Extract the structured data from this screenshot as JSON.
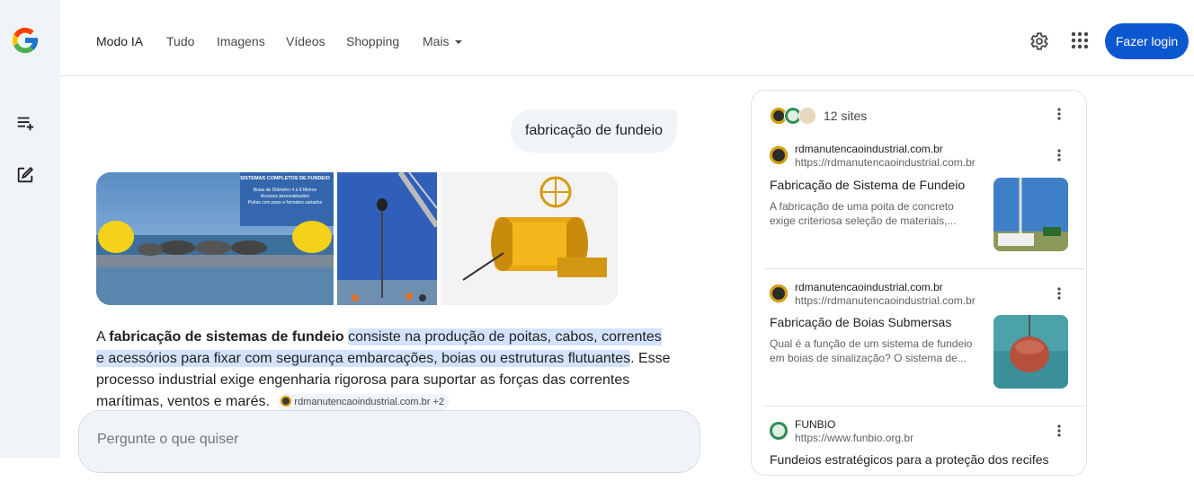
{
  "nav": {
    "tabs": [
      {
        "label": "Modo IA",
        "active": true
      },
      {
        "label": "Tudo"
      },
      {
        "label": "Imagens"
      },
      {
        "label": "Vídeos"
      },
      {
        "label": "Shopping"
      },
      {
        "label": "Mais"
      }
    ],
    "login_label": "Fazer login",
    "icons": [
      "settings-gear-icon",
      "apps-grid-icon"
    ]
  },
  "rail": {
    "icons": [
      "google-logo",
      "new-thread-icon",
      "edit-icon"
    ]
  },
  "colors": {
    "accent": "#0b57d0",
    "highlight": "#d3e3fd",
    "surface": "#f0f4f9"
  },
  "conversation": {
    "query": "fabricação de fundeio",
    "image_banner_text": {
      "title": "SISTEMAS COMPLETOS DE FUNDEIO",
      "lines": [
        "Boias de Diâmetro 4 à 8 Metros",
        "Acessos personalizados",
        "Poitas com peso e formatos variados"
      ]
    },
    "answer": {
      "part1": "A ",
      "bold": "fabricação de sistemas de fundeio",
      "part2": " ",
      "highlight": "consiste na produção de poitas, cabos, correntes e acessórios para fixar com segurança embarcações, boias ou estruturas flutuantes",
      "part3": ". Esse processo industrial exige engenharia rigorosa para suportar as forças das correntes marítimas, ventos e marés.",
      "chip_label": "rdmanutencaoindustrial.com.br",
      "chip_extra": "+2"
    }
  },
  "ask": {
    "placeholder": "Pergunte o que quiser"
  },
  "sources": {
    "count_label": "12 sites",
    "items": [
      {
        "domain": "rdmanutencaoindustrial.com.br",
        "url": "https://rdmanutencaoindustrial.com.br",
        "title": "Fabricação de Sistema de Fundeio",
        "snippet": "A fabricação de uma poita de concreto exige criteriosa seleção de materiais,..."
      },
      {
        "domain": "rdmanutencaoindustrial.com.br",
        "url": "https://rdmanutencaoindustrial.com.br",
        "title": "Fabricação de Boias Submersas",
        "snippet": "Qual é a função de um sistema de fundeio em boias de sinalização? O sistema de..."
      },
      {
        "domain": "FUNBIO",
        "url": "https://www.funbio.org.br",
        "title": "Fundeios estratégicos para a proteção dos recifes",
        "snippet": ""
      }
    ]
  }
}
